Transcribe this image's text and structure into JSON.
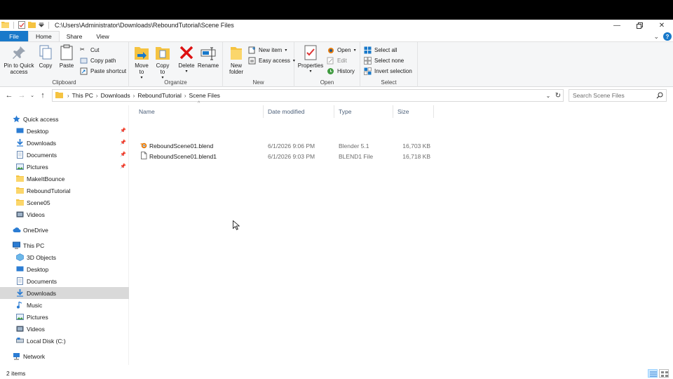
{
  "window": {
    "title_path": "C:\\Users\\Administrator\\Downloads\\ReboundTutorial\\Scene Files",
    "controls": [
      "minimize-icon",
      "restore-icon",
      "close-icon"
    ]
  },
  "tabs": {
    "file": "File",
    "home": "Home",
    "share": "Share",
    "view": "View"
  },
  "ribbon": {
    "clipboard": {
      "label": "Clipboard",
      "pin": "Pin to Quick access",
      "copy": "Copy",
      "paste": "Paste",
      "cut": "Cut",
      "copy_path": "Copy path",
      "paste_shortcut": "Paste shortcut"
    },
    "organize": {
      "label": "Organize",
      "move_to": "Move to",
      "copy_to": "Copy to",
      "delete": "Delete",
      "rename": "Rename"
    },
    "new": {
      "label": "New",
      "new_folder": "New folder",
      "new_item": "New item",
      "easy_access": "Easy access"
    },
    "open": {
      "label": "Open",
      "properties": "Properties",
      "open": "Open",
      "edit": "Edit",
      "history": "History"
    },
    "select": {
      "label": "Select",
      "select_all": "Select all",
      "select_none": "Select none",
      "invert": "Invert selection"
    }
  },
  "address": {
    "crumbs": [
      "This PC",
      "Downloads",
      "ReboundTutorial",
      "Scene Files"
    ],
    "search_placeholder": "Search Scene Files"
  },
  "nav": {
    "quick_access": "Quick access",
    "quick_items": [
      {
        "label": "Desktop",
        "pinned": true
      },
      {
        "label": "Downloads",
        "pinned": true
      },
      {
        "label": "Documents",
        "pinned": true
      },
      {
        "label": "Pictures",
        "pinned": true
      },
      {
        "label": "MakeItBounce"
      },
      {
        "label": "ReboundTutorial"
      },
      {
        "label": "Scene05"
      },
      {
        "label": "Videos"
      }
    ],
    "onedrive": "OneDrive",
    "this_pc": "This PC",
    "pc_items": [
      "3D Objects",
      "Desktop",
      "Documents",
      "Downloads",
      "Music",
      "Pictures",
      "Videos",
      "Local Disk (C:)"
    ],
    "network": "Network",
    "selected": "Downloads"
  },
  "columns": {
    "name": "Name",
    "date": "Date modified",
    "type": "Type",
    "size": "Size"
  },
  "files": [
    {
      "name": "ReboundScene01.blend",
      "date": "6/1/2026 9:06 PM",
      "type": "Blender 5.1",
      "size": "16,703 KB",
      "icon": "blender-file-icon"
    },
    {
      "name": "ReboundScene01.blend1",
      "date": "6/1/2026 9:03 PM",
      "type": "BLEND1 File",
      "size": "16,718 KB",
      "icon": "generic-file-icon"
    }
  ],
  "status": {
    "items": "2 items"
  },
  "colors": {
    "accent": "#1979ca",
    "folder": "#f5c341",
    "selected_bg": "#d9d9d9"
  }
}
